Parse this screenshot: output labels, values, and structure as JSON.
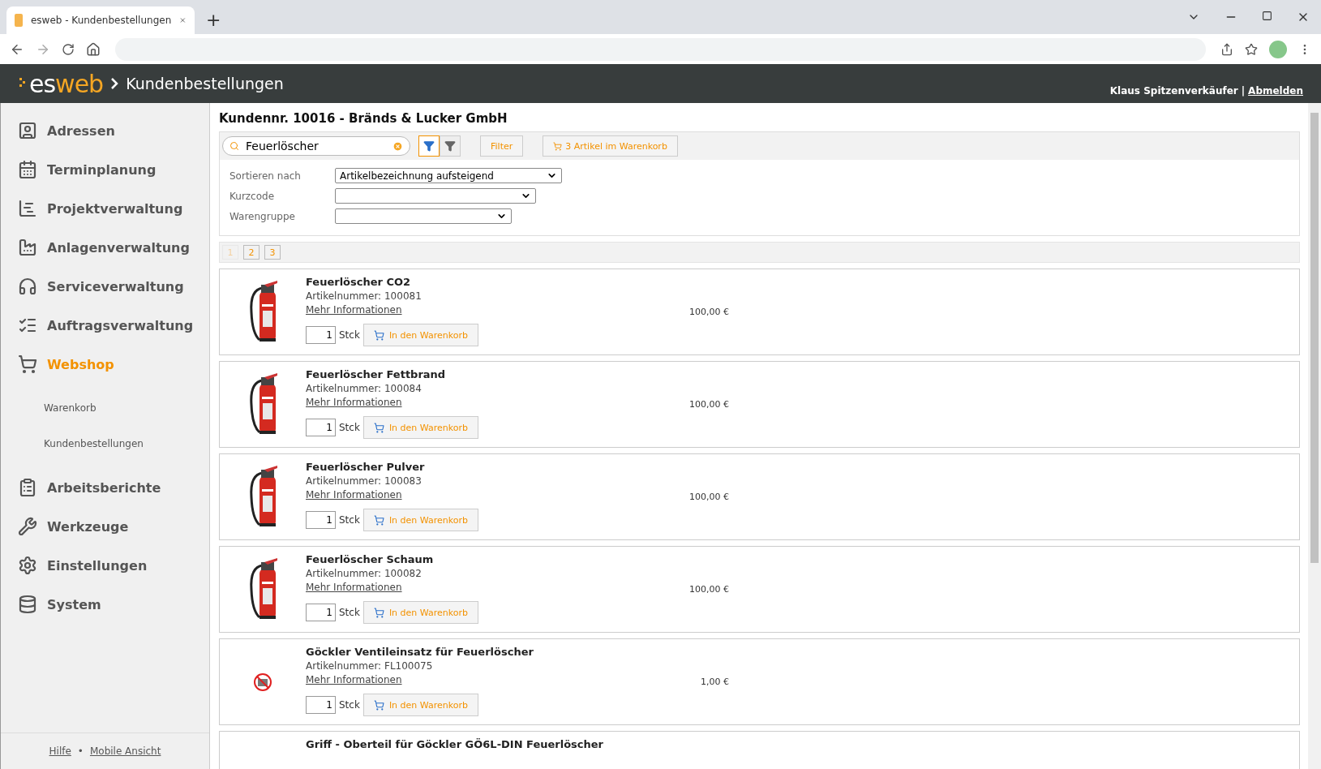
{
  "browser": {
    "tab_title": "esweb - Kundenbestellungen",
    "new_tab": "+"
  },
  "header": {
    "logo": {
      "prefix": "es",
      "suffix": "web"
    },
    "title": "Kundenbestellungen",
    "user": "Klaus Spitzenverkäufer",
    "separator": "|",
    "logout": "Abmelden"
  },
  "sidebar": {
    "items": [
      {
        "label": "Adressen",
        "selected": false
      },
      {
        "label": "Terminplanung",
        "selected": false
      },
      {
        "label": "Projektverwaltung",
        "selected": false
      },
      {
        "label": "Anlagenverwaltung",
        "selected": false
      },
      {
        "label": "Serviceverwaltung",
        "selected": false
      },
      {
        "label": "Auftragsverwaltung",
        "selected": false
      },
      {
        "label": "Webshop",
        "selected": true,
        "children": [
          {
            "label": "Warenkorb"
          },
          {
            "label": "Kundenbestellungen"
          }
        ]
      },
      {
        "label": "Arbeitsberichte",
        "selected": false
      },
      {
        "label": "Werkzeuge",
        "selected": false
      },
      {
        "label": "Einstellungen",
        "selected": false
      },
      {
        "label": "System",
        "selected": false
      }
    ],
    "footer": {
      "links": [
        "Hilfe",
        "Mobile Ansicht"
      ],
      "separator": "•"
    }
  },
  "main": {
    "title": "Kundennr. 10016 - Bränds & Lucker GmbH",
    "search": {
      "value": "Feuerlöscher"
    },
    "view_toggles": [
      {
        "selected": true
      },
      {
        "selected": false
      }
    ],
    "filter_button": "Filter",
    "cart_button": "3 Artikel im Warenkorb",
    "filters": [
      {
        "label": "Sortieren nach",
        "value": "Artikelbezeichnung aufsteigend"
      },
      {
        "label": "Kurzcode"
      },
      {
        "label": "Warengruppe"
      }
    ],
    "pages": [
      {
        "label": "1",
        "selected": true
      },
      {
        "label": "2",
        "selected": false
      },
      {
        "label": "3",
        "selected": false
      }
    ],
    "products": [
      {
        "kind": "extinguisher",
        "name": "Feuerlöscher CO2",
        "number": "Artikelnummer: 100081",
        "more": "Mehr Informationen",
        "quantity": "1",
        "unit": "Stck",
        "add": "In den Warenkorb",
        "price": "100,00 €"
      },
      {
        "kind": "extinguisher",
        "name": "Feuerlöscher Fettbrand",
        "number": "Artikelnummer: 100084",
        "more": "Mehr Informationen",
        "quantity": "1",
        "unit": "Stck",
        "add": "In den Warenkorb",
        "price": "100,00 €"
      },
      {
        "kind": "extinguisher",
        "name": "Feuerlöscher Pulver",
        "number": "Artikelnummer: 100083",
        "more": "Mehr Informationen",
        "quantity": "1",
        "unit": "Stck",
        "add": "In den Warenkorb",
        "price": "100,00 €"
      },
      {
        "kind": "extinguisher",
        "name": "Feuerlöscher Schaum",
        "number": "Artikelnummer: 100082",
        "more": "Mehr Informationen",
        "quantity": "1",
        "unit": "Stck",
        "add": "In den Warenkorb",
        "price": "100,00 €"
      },
      {
        "kind": "missing",
        "name": "Göckler Ventileinsatz für Feuerlöscher",
        "number": "Artikelnummer: FL100075",
        "more": "Mehr Informationen",
        "quantity": "1",
        "unit": "Stck",
        "add": "In den Warenkorb",
        "price": "1,00 €"
      },
      {
        "name": "Griff - Oberteil für Göckler GÖ6L-DIN Feuerlöscher"
      }
    ]
  }
}
